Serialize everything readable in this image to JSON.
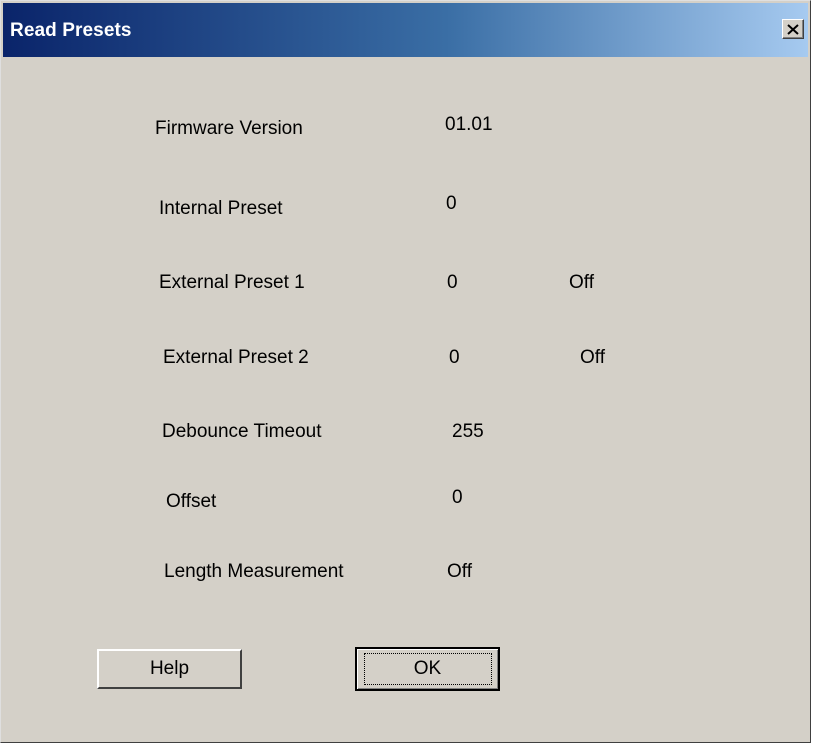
{
  "window": {
    "title": "Read Presets",
    "close_glyph": "×"
  },
  "fields": [
    {
      "label": "Firmware Version",
      "value": "01.01",
      "extra": ""
    },
    {
      "label": "Internal Preset",
      "value": "0",
      "extra": ""
    },
    {
      "label": "External Preset 1",
      "value": "0",
      "extra": "Off"
    },
    {
      "label": "External Preset 2",
      "value": "0",
      "extra": "Off"
    },
    {
      "label": "Debounce Timeout",
      "value": "255",
      "extra": ""
    },
    {
      "label": "Offset",
      "value": "0",
      "extra": ""
    },
    {
      "label": "Length Measurement",
      "value": "Off",
      "extra": ""
    }
  ],
  "buttons": {
    "help_label": "Help",
    "ok_label": "OK"
  },
  "colors": {
    "titlebar_start": "#0a246a",
    "titlebar_end": "#a6caf0",
    "face": "#d4d0c8"
  }
}
